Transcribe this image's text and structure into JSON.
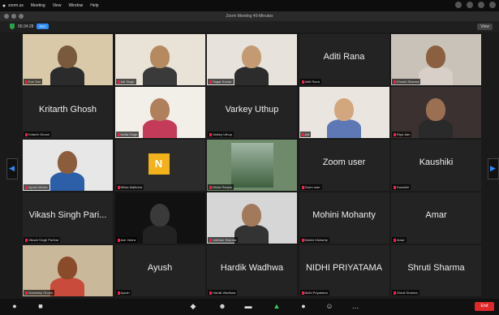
{
  "menubar": {
    "items": [
      "zoom.us",
      "Meeting",
      "View",
      "Window",
      "Help"
    ]
  },
  "window": {
    "title": "Zoom Meeting  40-Minutes"
  },
  "topbar": {
    "info": "00:34:28",
    "rec": "REC",
    "view": "View"
  },
  "tiles": [
    {
      "name": "",
      "label": "Kun Son",
      "video": true,
      "active": true
    },
    {
      "name": "",
      "label": "Adi Singh",
      "video": true
    },
    {
      "name": "",
      "label": "Sagar Kumar",
      "video": true
    },
    {
      "name": "Aditi Rana",
      "label": "Aditi Rana",
      "video": false
    },
    {
      "name": "",
      "label": "Khushi Sharma",
      "video": true
    },
    {
      "name": "Kritarth Ghosh",
      "label": "Kritarth Ghosh",
      "video": false
    },
    {
      "name": "",
      "label": "Ishita Singh",
      "video": true
    },
    {
      "name": "Varkey Uthup",
      "label": "Varkey Uthup",
      "video": false
    },
    {
      "name": "",
      "label": "Adi",
      "video": true
    },
    {
      "name": "",
      "label": "Riya Jain",
      "video": true
    },
    {
      "name": "",
      "label": "Ayush Mehra",
      "video": true
    },
    {
      "name": "",
      "label": "Nikita Malhotra",
      "video": true
    },
    {
      "name": "",
      "label": "Nisha Ranjan",
      "video": true
    },
    {
      "name": "Zoom user",
      "label": "Zoom user",
      "video": false
    },
    {
      "name": "Kaushiki",
      "label": "Kaushiki",
      "video": false
    },
    {
      "name": "Vikash Singh Pari...",
      "label": "Vikash Singh Parihar",
      "video": false
    },
    {
      "name": "",
      "label": "Ash Vohra",
      "video": true
    },
    {
      "name": "",
      "label": "Vaibhav Sharma",
      "video": true
    },
    {
      "name": "Mohini Mohanty",
      "label": "Mohini Mohanty",
      "video": false
    },
    {
      "name": "Amar",
      "label": "Amar",
      "video": false
    },
    {
      "name": "",
      "label": "Somdeep Ghosh",
      "video": true
    },
    {
      "name": "Ayush",
      "label": "Ayush",
      "video": false
    },
    {
      "name": "Hardik Wadhwa",
      "label": "Hardik Wadhwa",
      "video": false
    },
    {
      "name": "NIDHI PRIYATAMA",
      "label": "Nidhi Priyatama",
      "video": false
    },
    {
      "name": "Shruti Sharma",
      "label": "Shruti Sharma",
      "video": false
    }
  ],
  "toolbar": {
    "end": "End"
  },
  "colors": {
    "accent": "#2d8cff",
    "active_outline": "#f1d54a",
    "end": "#e02828"
  }
}
